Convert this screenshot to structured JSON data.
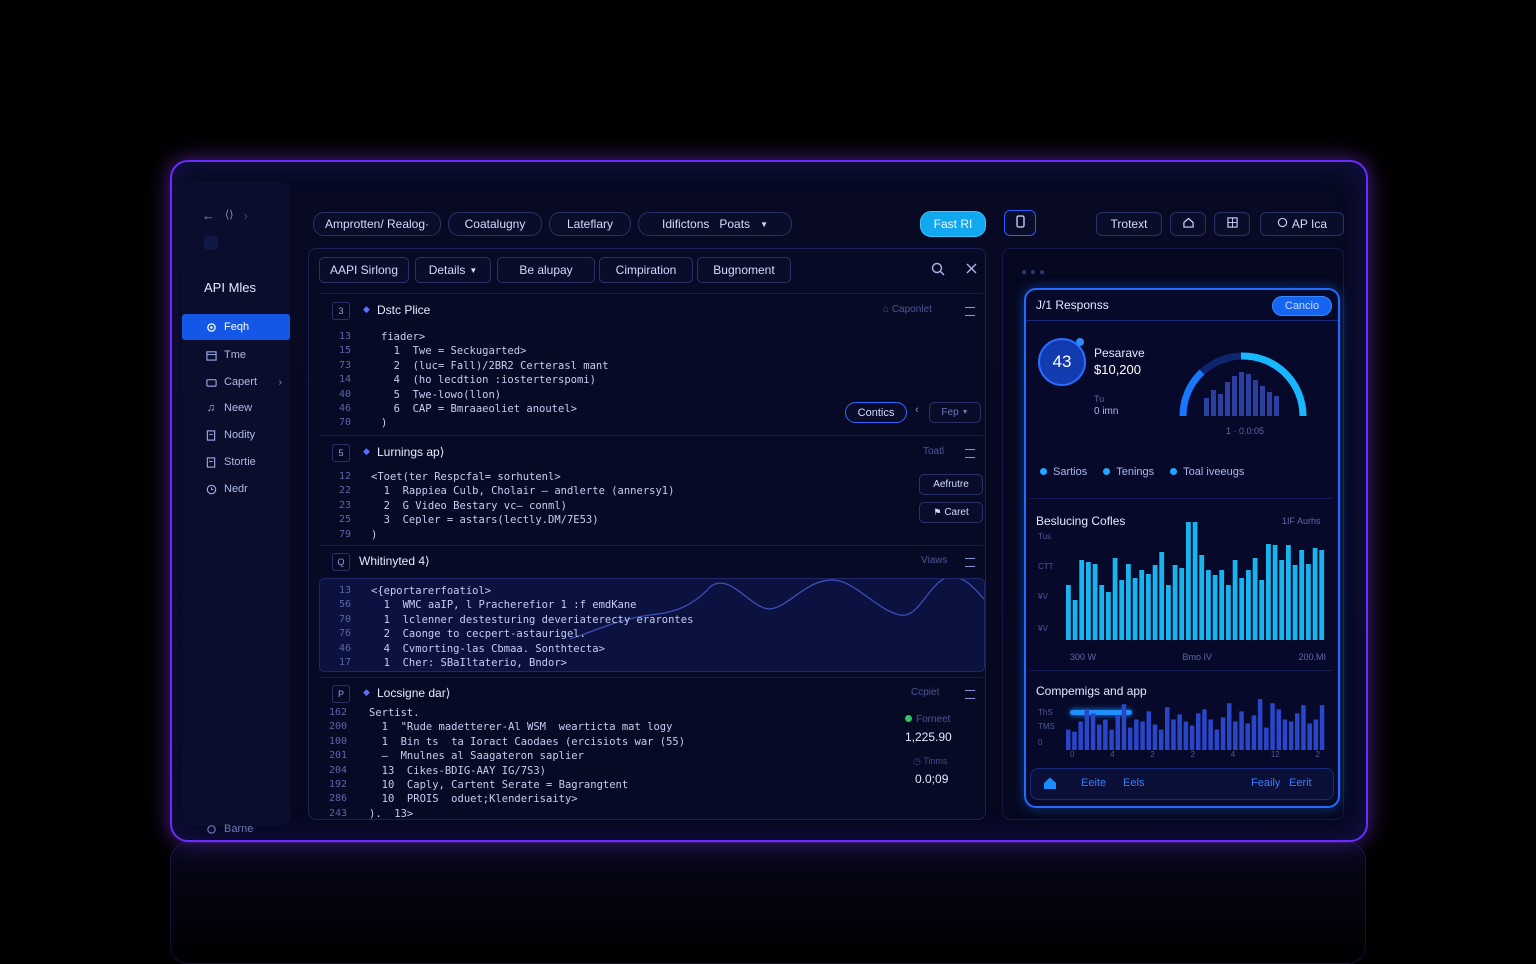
{
  "sidebar": {
    "nav": {
      "back": "←",
      "mid": "⟨⟩",
      "fwd": "›"
    },
    "title": "API Mles",
    "items": [
      {
        "label": "Feqh",
        "icon": "gear-icon"
      },
      {
        "label": "Tme",
        "icon": "calendar-icon"
      },
      {
        "label": "Capert",
        "icon": "folder-icon"
      },
      {
        "label": "Neew",
        "icon": "music-icon"
      },
      {
        "label": "Nodity",
        "icon": "doc-icon"
      },
      {
        "label": "Stortie",
        "icon": "doc-icon"
      },
      {
        "label": "Nedr",
        "icon": "clock-icon"
      }
    ],
    "footer": "Barne"
  },
  "topbar": {
    "tabs": [
      "Amprotten/ Realog·",
      "Coatalugny",
      "Lateflary",
      "Idifictons",
      "Poats"
    ],
    "cyan_button": "Fast RI",
    "right": {
      "text": "Trotext",
      "api": "AP Ica"
    }
  },
  "main": {
    "tabs": [
      "AAPI Sirlong",
      "Details",
      "Be alupay",
      "Cimpiration",
      "Bugnoment"
    ],
    "sections": [
      {
        "num": "3",
        "title": "Dstc Plice",
        "right_label": "Caponlet",
        "line_numbers": [
          "13",
          "15",
          "73",
          "14",
          "40",
          "46",
          "70"
        ],
        "code": [
          "fiader>",
          "  1  Twe = Seckugarted>",
          "  2  (luc= Fall)/2BR2 Certerasl mant",
          "  4  (ho lecdtion :iosterterspomi)",
          "  5  Twe-lowo(llon)",
          "  6  CAP = Bmraaeoliet anoutel>",
          ")"
        ],
        "button": "Contics",
        "dropdown": "Fep"
      },
      {
        "num": "5",
        "title": "Lurnings ap⟩",
        "right_label": "Toatl",
        "line_numbers": [
          "12",
          "22",
          "23",
          "25",
          "79"
        ],
        "code": [
          "<Toet(ter Respcfal= sorhutenl>",
          "  1  Rappiea Culb, Cholair – andlerte (annersy1)",
          "  2  G Video Bestary vc— conml)",
          "  3  Cepler = astars(lectly.DM/7E53)",
          ")"
        ],
        "buttons": [
          "Aefrutre",
          "Caret"
        ]
      },
      {
        "num": "Q",
        "title": "Whitinyted 4⟩",
        "right_label": "Viaws",
        "line_numbers": [
          "13",
          "56",
          "70",
          "76",
          "46",
          "17"
        ],
        "code": [
          "<{eportarerfoatiol>",
          "  1  WMC aaIP, l Pracherefior 1 :f emdKane",
          "  1  lclenner destesturing deveriaterecty erarontes",
          "  2  Caonge to cecpert-astaurigel.",
          "  4  Cvmorting-las Cbmaa. Sonthtecta>",
          "  1  Cher: SBaIltaterio, Bndor>"
        ]
      },
      {
        "num": "P",
        "title": "Locsigne dar⟩",
        "right_label": "Ccpiet",
        "line_numbers": [
          "162",
          "200",
          "100",
          "201",
          "204",
          "192",
          "286",
          "243"
        ],
        "code": [
          "Sertist.",
          "  1  \"Rude madetterer-Al WSM  wearticta mat logy",
          "  1  Bin ts  ta Ioract Caodaes (ercisiots war (55)",
          "  —  Mnulnes al Saagateron saplier",
          "  13  Cikes-BDIG-AAY IG/7S3)",
          "  10  Caply, Cartent Serate = Bagrangtent",
          "  10  PROIS  oduet;Klenderisaity>",
          ").  13>"
        ],
        "stats": [
          {
            "label": "Forneet",
            "value": "1,225.90"
          },
          {
            "label": "Tinms",
            "value": "0.0;09"
          }
        ]
      }
    ]
  },
  "right_card": {
    "title": "J/1 Responss",
    "button": "Cancio",
    "badge": "43",
    "metric_label": "Pesarave",
    "metric_value": "$10,200",
    "sub1": "Tu",
    "sub2": "0 imn",
    "gauge_label": "1 · 0.0:05",
    "legend": [
      "Sartios",
      "Tenings",
      "Toal iveeugs"
    ],
    "chart1_title": "Beslucing Cofles",
    "chart1_right": "1IF Aurhs",
    "chart1_y": [
      "Tus",
      "CTT",
      "¥V",
      "¥V"
    ],
    "chart1_x": [
      "300 W",
      "Bmo IV",
      "200.MI"
    ],
    "chart2_title": "Compemigs and app",
    "chart2_y": [
      "ThS",
      "TMS",
      "0"
    ],
    "chart2_x": [
      "0",
      "4",
      "2",
      "2",
      "4",
      "12",
      "2"
    ],
    "footer": {
      "a": "Eeite",
      "b": "Eels",
      "c": "Feaily",
      "d": "Eerit"
    }
  },
  "chart_data": [
    {
      "type": "bar",
      "title": "Beslucing Cofles",
      "values": [
        55,
        40,
        80,
        78,
        76,
        55,
        48,
        82,
        60,
        76,
        62,
        70,
        66,
        75,
        88,
        55,
        75,
        72,
        118,
        118,
        85,
        70,
        65,
        70,
        55,
        80,
        62,
        70,
        82,
        60,
        96,
        95,
        80,
        95,
        75,
        90,
        76,
        92,
        90
      ],
      "ylim": [
        0,
        120
      ]
    },
    {
      "type": "bar",
      "title": "Compemigs and app",
      "values": [
        20,
        18,
        28,
        40,
        36,
        25,
        30,
        20,
        34,
        45,
        22,
        30,
        28,
        38,
        25,
        20,
        42,
        30,
        35,
        28,
        24,
        36,
        40,
        30,
        20,
        32,
        46,
        28,
        38,
        26,
        34,
        50,
        22,
        46,
        40,
        30,
        28,
        36,
        44,
        26,
        30,
        44
      ],
      "ylim": [
        0,
        55
      ]
    }
  ]
}
